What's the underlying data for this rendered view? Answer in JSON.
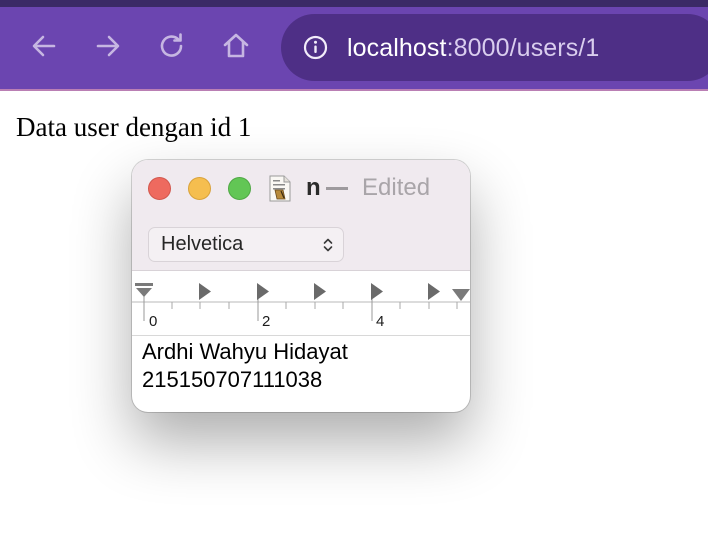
{
  "browser": {
    "url_host": "localhost",
    "url_path": ":8000/users/1",
    "accent_color": "#6b45b0",
    "url_bar_color": "#4e2f86",
    "nav_icons": [
      "back-arrow-icon",
      "forward-arrow-icon",
      "reload-icon",
      "home-icon"
    ],
    "info_icon": "info-icon"
  },
  "page": {
    "heading": "Data user dengan id 1"
  },
  "textedit": {
    "title": "n",
    "status": "Edited",
    "font": "Helvetica",
    "ruler_labels": [
      "0",
      "2",
      "4"
    ],
    "content_lines": [
      "Ardhi Wahyu Hidayat",
      "215150707111038"
    ],
    "traffic_light_colors": {
      "close": "#ee6a5f",
      "minimize": "#f5be4f",
      "zoom": "#62c655"
    }
  }
}
